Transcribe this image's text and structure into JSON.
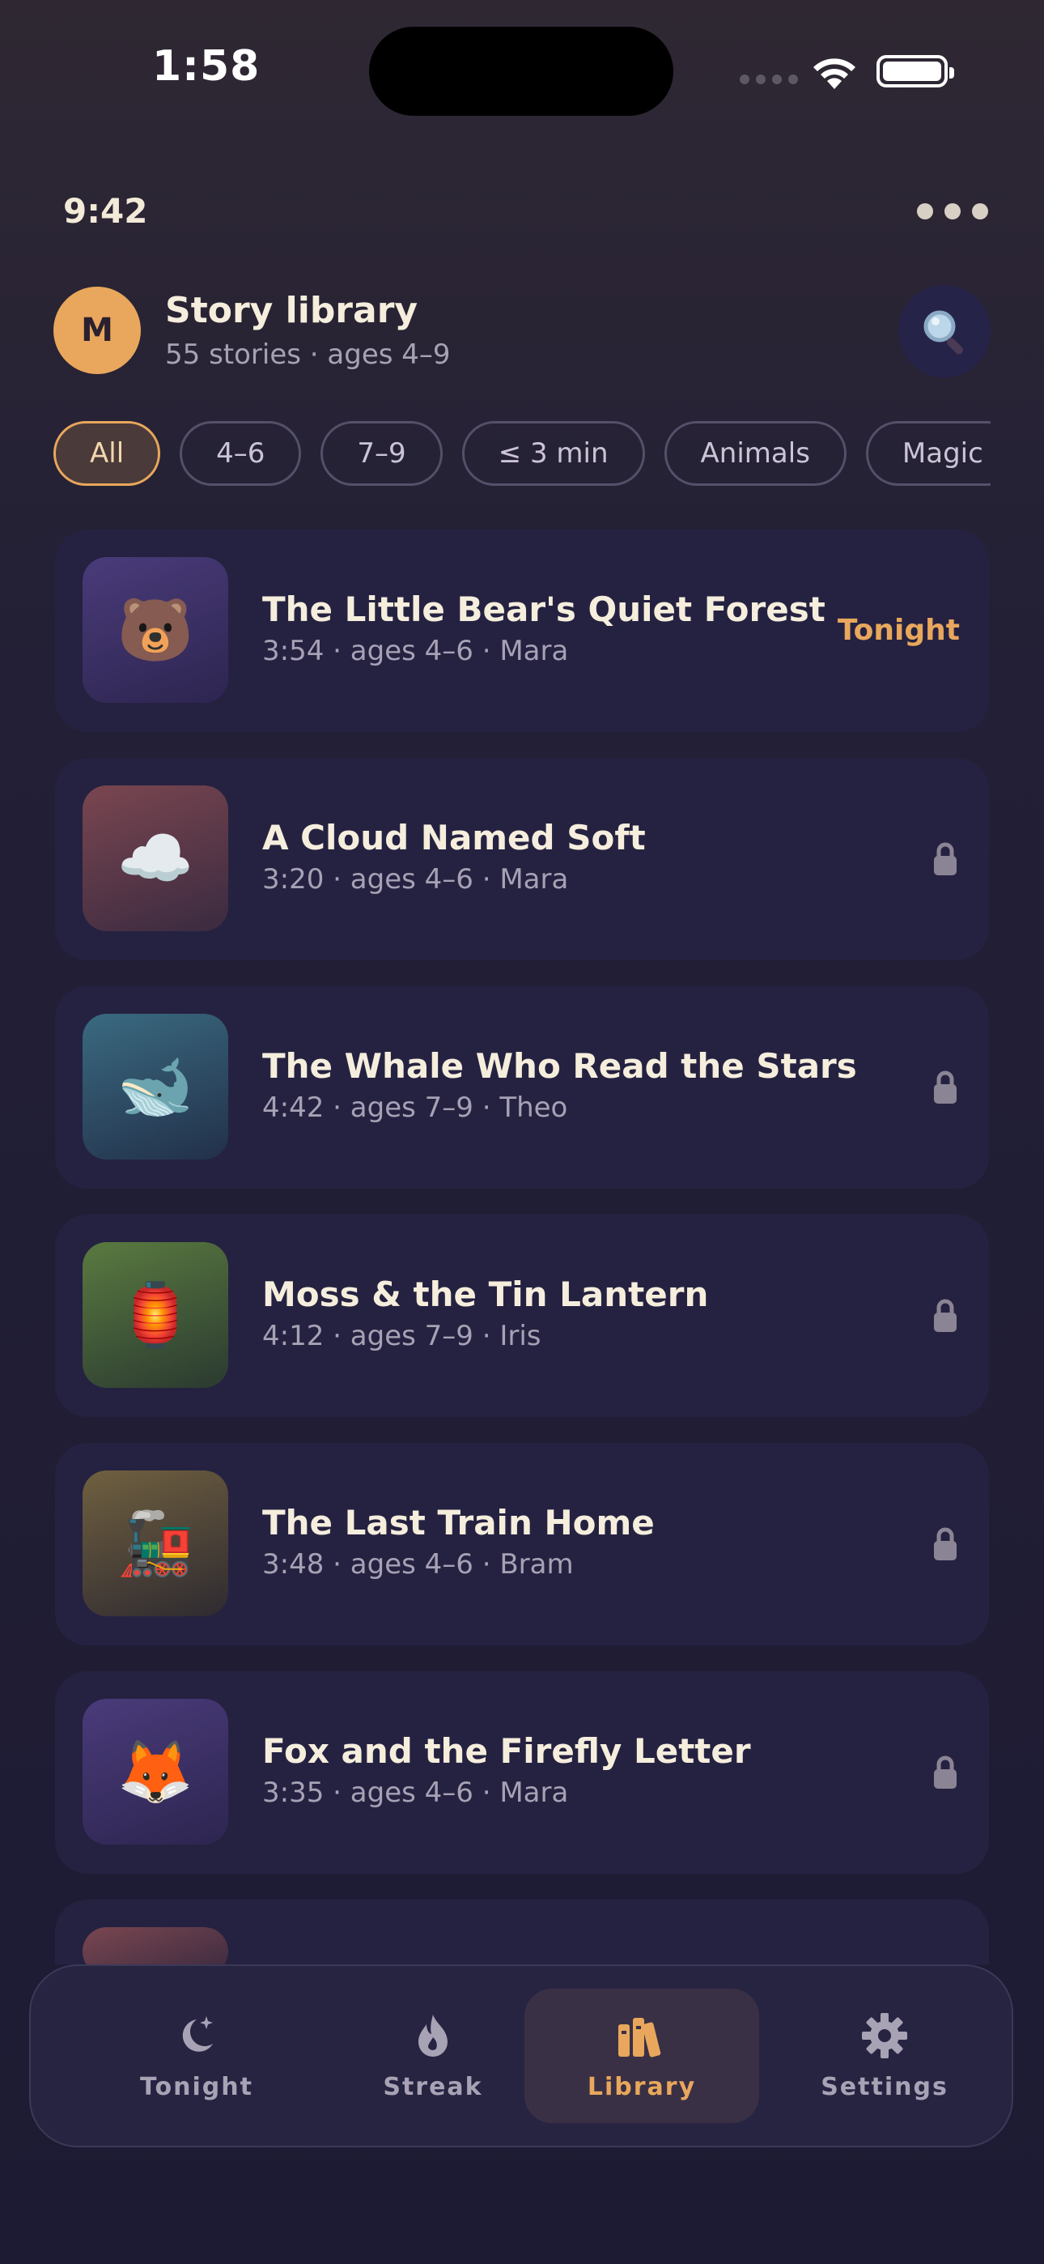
{
  "status_bar": {
    "time": "1:58"
  },
  "app_bar": {
    "time": "9:42",
    "more_icon": "more-dots-icon"
  },
  "header": {
    "avatar_initial": "M",
    "title": "Story library",
    "subtitle": "55 stories · ages 4–9",
    "search_icon": "search-icon"
  },
  "filters": {
    "selected": "All",
    "chips": [
      "All",
      "4–6",
      "7–9",
      "≤ 3 min",
      "Animals",
      "Magic"
    ]
  },
  "stories": [
    {
      "emoji": "🐻",
      "title": "The Little Bear's Quiet Forest",
      "meta": "3:54 · ages 4–6 · Mara",
      "badge": "Tonight",
      "locked": false,
      "thumb_colors": [
        "#4a3b7a",
        "#2d2550"
      ]
    },
    {
      "emoji": "☁️",
      "title": "A Cloud Named Soft",
      "meta": "3:20 · ages 4–6 · Mara",
      "badge": "",
      "locked": true,
      "thumb_colors": [
        "#7a4650",
        "#3a2a40"
      ]
    },
    {
      "emoji": "🐋",
      "title": "The Whale Who Read the Stars",
      "meta": "4:42 · ages 7–9 · Theo",
      "badge": "",
      "locked": true,
      "thumb_colors": [
        "#3a6a80",
        "#22304a"
      ]
    },
    {
      "emoji": "🏮",
      "title": "Moss & the Tin Lantern",
      "meta": "4:12 · ages 7–9 · Iris",
      "badge": "",
      "locked": true,
      "thumb_colors": [
        "#5a7a40",
        "#2a3a30"
      ]
    },
    {
      "emoji": "🚂",
      "title": "The Last Train Home",
      "meta": "3:48 · ages 4–6 · Bram",
      "badge": "",
      "locked": true,
      "thumb_colors": [
        "#706040",
        "#2e2a30"
      ]
    },
    {
      "emoji": "🦊",
      "title": "Fox and the Firefly Letter",
      "meta": "3:35 · ages 4–6 · Mara",
      "badge": "",
      "locked": true,
      "thumb_colors": [
        "#4a3b7a",
        "#2d2550"
      ]
    }
  ],
  "tabs": [
    {
      "label": "Tonight",
      "icon": "moon-stars-icon",
      "active": false
    },
    {
      "label": "Streak",
      "icon": "flame-icon",
      "active": false
    },
    {
      "label": "Library",
      "icon": "books-icon",
      "active": true
    },
    {
      "label": "Settings",
      "icon": "gear-icon",
      "active": false
    }
  ],
  "colors": {
    "accent": "#e8a75c",
    "card": "#252241",
    "background": "#1d1b33"
  }
}
